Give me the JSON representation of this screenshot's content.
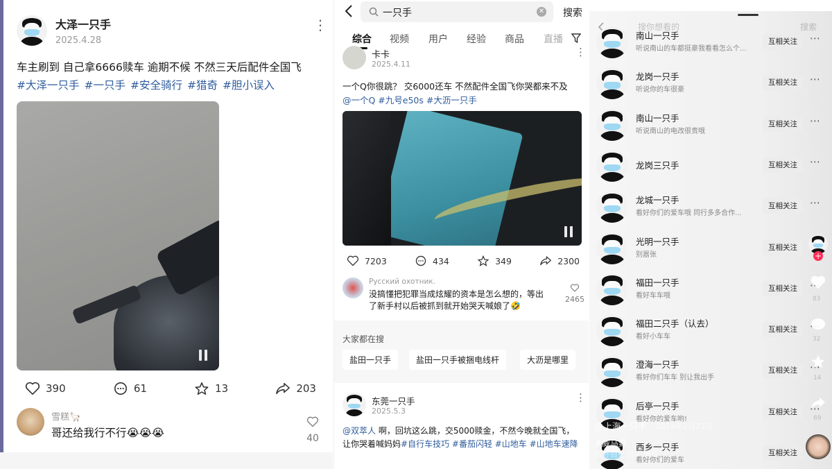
{
  "left": {
    "author": "大泽一只手",
    "date": "2025.4.28",
    "text": "车主刷到 自己拿6666赎车 逾期不候 不然三天后配件全国飞",
    "tags": [
      "#大泽一只手",
      "#一只手",
      "#安全骑行",
      "#猎奇",
      "#胆小误入"
    ],
    "likes": "390",
    "comments": "61",
    "favorites": "13",
    "shares": "203",
    "commenter": "雪糕🦙",
    "comment_text": "哥还给我行不行😭😭😭",
    "comment_likes": "40"
  },
  "middle": {
    "search_query": "一只手",
    "search_button": "搜索",
    "tabs": [
      "综合",
      "视频",
      "用户",
      "经验",
      "商品",
      "直播"
    ],
    "post1": {
      "author": "卡卡",
      "date": "2025.4.11",
      "text": "一个Q你很跳？ 交6000还车 不然配件全国飞你哭都来不及",
      "tags": "@一个Q #九号e50s #大沥一只手",
      "likes": "7203",
      "comments": "434",
      "favorites": "349",
      "shares": "2300",
      "commenter": "Русский охотник.",
      "comment_text": "没搞懂把犯罪当成炫耀的资本是怎么想的，等出了新手村以后被抓到就开始哭天喊娘了🤣",
      "comment_likes": "2465"
    },
    "suggest_title": "大家都在搜",
    "suggestions": [
      "盐田一只手",
      "盐田一只手被捆电线杆",
      "大沥是哪里"
    ],
    "post2": {
      "author": "东莞一只手",
      "date": "2025.5.3",
      "text_mention": "@双萃人",
      "text_body": " 啊，回坑这么跳，交5000赎金，不然今晚就全国飞，让你哭着喊妈妈",
      "text_tags": "#自行车技巧 #番茄闪轻 #山地车 #山地车速降"
    }
  },
  "right": {
    "search_placeholder": "搜你想看的",
    "search_button": "搜索",
    "follow_label": "互相关注",
    "users": [
      {
        "name": "南山一只手",
        "desc": "听说南山的车都挺豪我看看怎么个..."
      },
      {
        "name": "龙岗一只手",
        "desc": "听说你的车很豪"
      },
      {
        "name": "南山一只手",
        "desc": "听说南山的电改很贵哦"
      },
      {
        "name": "龙岗三只手",
        "desc": ""
      },
      {
        "name": "龙城一只手",
        "desc": "看好你们的爱车哦 同行多多合作..."
      },
      {
        "name": "光明一只手",
        "desc": "别嚣张"
      },
      {
        "name": "福田一只手",
        "desc": "看好车车哦"
      },
      {
        "name": "福田二只手（认去）",
        "desc": "看好小车车"
      },
      {
        "name": "澄海一只手",
        "desc": "看好你们车车 别让我出手"
      },
      {
        "name": "后亭一只手",
        "desc": "看好你的爱车哟!"
      },
      {
        "name": "西乡一只手",
        "desc": "看好你们的爱车"
      }
    ],
    "side_counts": [
      "83",
      "32",
      "14",
      "69"
    ],
    "overlay_author": "@上海一只手",
    "overlay_date": "2024年2月23日",
    "overlay_tag": "#威马野",
    "overlay_desc": "看好自己的车 展开"
  },
  "colors": {
    "hashtag": "#2f5c9c",
    "divider": "#f0f0f0",
    "follow_bg": "#f3f3f3"
  }
}
